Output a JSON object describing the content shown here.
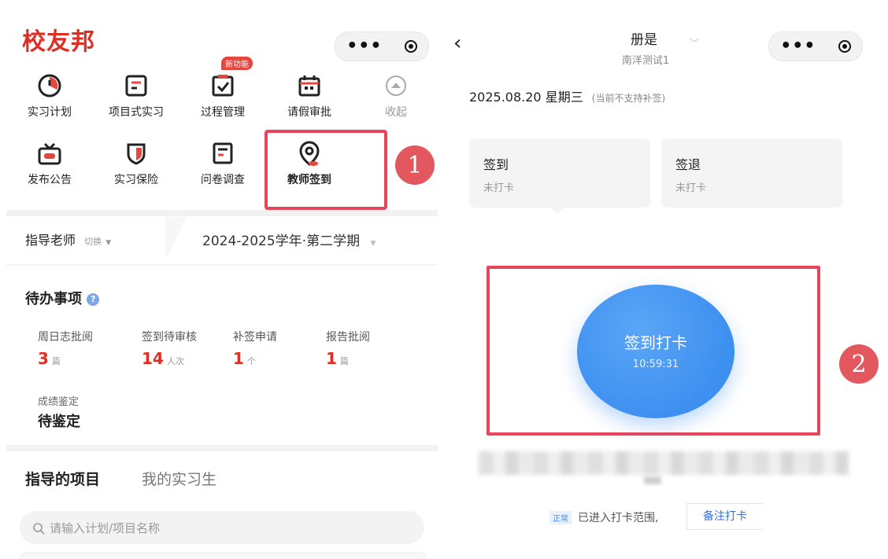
{
  "left": {
    "brand": "校友邦",
    "new_badge": "新功能",
    "menu_row1": [
      {
        "label": "实习计划",
        "icon": "clock-icon"
      },
      {
        "label": "项目式实习",
        "icon": "document-icon"
      },
      {
        "label": "过程管理",
        "icon": "checkbox-icon"
      },
      {
        "label": "请假审批",
        "icon": "calendar-icon"
      },
      {
        "label": "收起",
        "icon": "collapse-icon"
      }
    ],
    "menu_row2": [
      {
        "label": "发布公告",
        "icon": "announcement-icon"
      },
      {
        "label": "实习保险",
        "icon": "shield-icon"
      },
      {
        "label": "问卷调查",
        "icon": "survey-icon"
      },
      {
        "label": "教师签到",
        "icon": "location-pin-icon"
      }
    ],
    "role": "指导老师",
    "switch": "切换",
    "semester": "2024-2025学年·第二学期",
    "todo_title": "待办事项",
    "todos": [
      {
        "label": "周日志批阅",
        "value": "3",
        "unit": "篇"
      },
      {
        "label": "签到待审核",
        "value": "14",
        "unit": "人次"
      },
      {
        "label": "补签申请",
        "value": "1",
        "unit": "个"
      },
      {
        "label": "报告批阅",
        "value": "1",
        "unit": "篇"
      }
    ],
    "grade_label": "成绩鉴定",
    "grade_value": "待鉴定",
    "tab_active": "指导的项目",
    "tab_other": "我的实习生",
    "search_placeholder": "请输入计划/项目名称"
  },
  "right": {
    "title": "册是",
    "subtitle": "南洋测试1",
    "date": "2025.08.20 星期三",
    "date_note": "(当前不支持补签)",
    "checkin_title": "签到",
    "checkin_status": "未打卡",
    "checkout_title": "签退",
    "checkout_status": "未打卡",
    "punch_label": "签到打卡",
    "punch_time": "10:59:31",
    "range_badge": "正常",
    "range_text": "已进入打卡范围,",
    "note_button": "备注打卡"
  },
  "callouts": [
    "1",
    "2"
  ],
  "colors": {
    "brand_red": "#e02e24",
    "highlight_red": "#e8455a",
    "punch_blue": "#3d8ff0",
    "callout_red": "#e3575f"
  }
}
